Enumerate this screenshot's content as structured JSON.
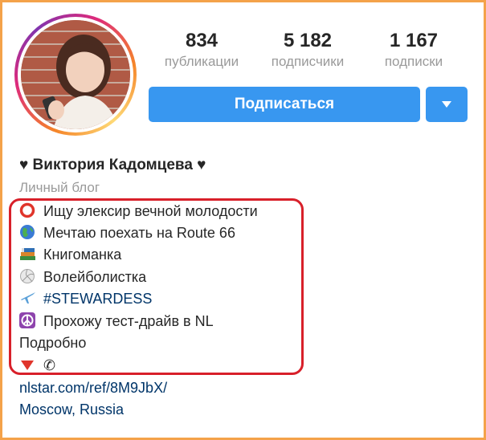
{
  "profile": {
    "name": "♥ Виктория Кадомцева ♥",
    "category": "Личный блог"
  },
  "stats": {
    "posts": {
      "value": "834",
      "label": "публикации"
    },
    "followers": {
      "value": "5 182",
      "label": "подписчики"
    },
    "following": {
      "value": "1 167",
      "label": "подписки"
    }
  },
  "actions": {
    "follow_label": "Подписаться",
    "more_icon": "chevron-down-icon"
  },
  "bio": {
    "lines": [
      {
        "icon": "red-circle-icon",
        "text": "Ищу элексир вечной молодости"
      },
      {
        "icon": "globe-icon",
        "text": "Мечтаю поехать на Route 66"
      },
      {
        "icon": "books-icon",
        "text": "Книгоманка"
      },
      {
        "icon": "volleyball-icon",
        "text": "Волейболистка"
      },
      {
        "icon": "airplane-icon",
        "text": "#STEWARDESS"
      },
      {
        "icon": "peace-icon",
        "text": "Прохожу тест-драйв в NL"
      }
    ],
    "more": "Подробно",
    "last_line_symbol": "✆"
  },
  "links": {
    "website": "nlstar.com/ref/8M9JbX/",
    "location": "Moscow, Russia"
  },
  "colors": {
    "accent": "#3897f0",
    "highlight_border": "#d8202a",
    "frame_border": "#f4a24a",
    "link": "#003569"
  }
}
